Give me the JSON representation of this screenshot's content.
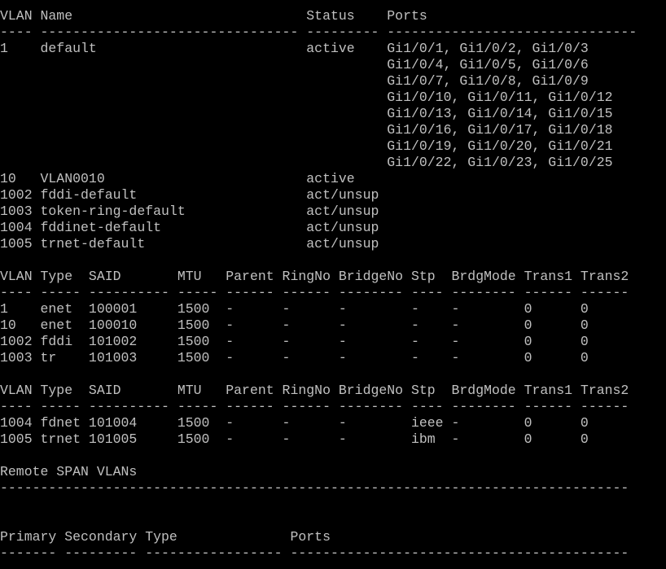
{
  "terminal": {
    "lines": [
      "VLAN Name                             Status    Ports",
      "---- -------------------------------- --------- -------------------------------",
      "1    default                          active    Gi1/0/1, Gi1/0/2, Gi1/0/3",
      "                                                Gi1/0/4, Gi1/0/5, Gi1/0/6",
      "                                                Gi1/0/7, Gi1/0/8, Gi1/0/9",
      "                                                Gi1/0/10, Gi1/0/11, Gi1/0/12",
      "                                                Gi1/0/13, Gi1/0/14, Gi1/0/15",
      "                                                Gi1/0/16, Gi1/0/17, Gi1/0/18",
      "                                                Gi1/0/19, Gi1/0/20, Gi1/0/21",
      "                                                Gi1/0/22, Gi1/0/23, Gi1/0/25",
      "10   VLAN0010                         active",
      "1002 fddi-default                     act/unsup",
      "1003 token-ring-default               act/unsup",
      "1004 fddinet-default                  act/unsup",
      "1005 trnet-default                    act/unsup",
      "",
      "VLAN Type  SAID       MTU   Parent RingNo BridgeNo Stp  BrdgMode Trans1 Trans2",
      "---- ----- ---------- ----- ------ ------ -------- ---- -------- ------ ------",
      "1    enet  100001     1500  -      -      -        -    -        0      0",
      "10   enet  100010     1500  -      -      -        -    -        0      0",
      "1002 fddi  101002     1500  -      -      -        -    -        0      0",
      "1003 tr    101003     1500  -      -      -        -    -        0      0",
      "",
      "VLAN Type  SAID       MTU   Parent RingNo BridgeNo Stp  BrdgMode Trans1 Trans2",
      "---- ----- ---------- ----- ------ ------ -------- ---- -------- ------ ------",
      "1004 fdnet 101004     1500  -      -      -        ieee -        0      0",
      "1005 trnet 101005     1500  -      -      -        ibm  -        0      0",
      "",
      "Remote SPAN VLANs",
      "------------------------------------------------------------------------------",
      "",
      "",
      "Primary Secondary Type              Ports",
      "------- --------- ----------------- ------------------------------------------"
    ]
  }
}
